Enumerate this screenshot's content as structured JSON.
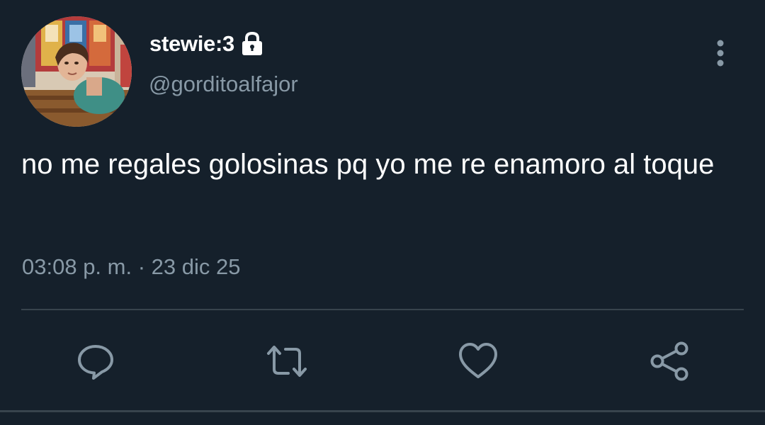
{
  "tweet": {
    "author": {
      "display_name": "stewie:3",
      "handle": "@gorditoalfajor",
      "avatar_icon": "profile-photo",
      "protected_icon": "lock-icon"
    },
    "text": "no me regales golosinas pq yo me re enamoro al toque",
    "time": "03:08 p. m.",
    "separator": "·",
    "date": "23 dic 25"
  },
  "actions": {
    "reply_icon": "speech-bubble-icon",
    "retweet_icon": "retweet-icon",
    "like_icon": "heart-icon",
    "share_icon": "share-icon",
    "more_icon": "vertical-dots-icon"
  },
  "colors": {
    "background": "#15202b",
    "text_primary": "#ffffff",
    "text_secondary": "#8899a6",
    "icon": "#8899a6",
    "divider": "#38444d"
  }
}
